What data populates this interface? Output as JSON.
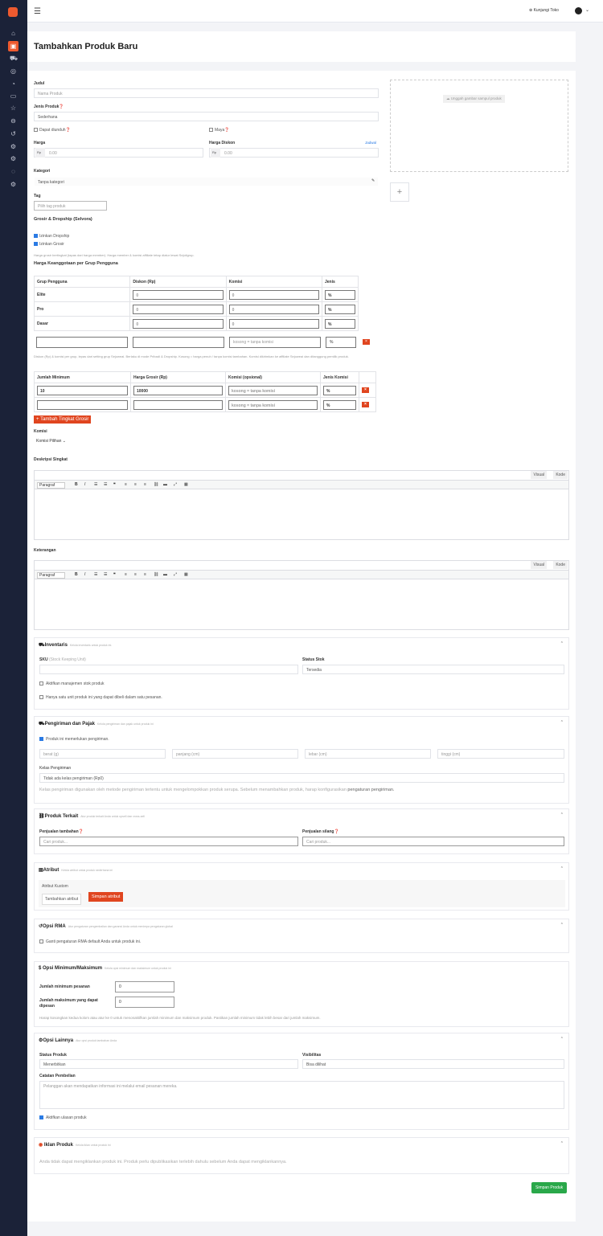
{
  "topbar": {
    "visit": "Kunjungi Toko"
  },
  "page": {
    "title": "Tambahkan Produk Baru"
  },
  "form": {
    "title_label": "Judul",
    "title_ph": "Nama Produk",
    "type_label": "Jenis Produk",
    "type_val": "Sederhana",
    "downloadable": "Dapat diunduh",
    "virtual": "Maya",
    "price_label": "Harga",
    "price_ph": "0.00",
    "currency": "Rp",
    "sale_label": "Harga Diskon",
    "schedule": "Jadwal",
    "cat_label": "Kategori",
    "cat_val": "Tanpa kategori",
    "tag_label": "Tag",
    "tag_ph": "Pilih tag produk",
    "upload": "Unggah gambar sampul produk"
  },
  "grosir": {
    "title": "Grosir & Dropship (Selvora)",
    "allow_dropship": "Izinkan Dropship",
    "allow_grosir": "Izinkan Grosir",
    "note": "Harga grosir bertingkat (tapas dari harga member). Harga member & komisi affiliate tetap diatur lewat Sejoligrup.",
    "member_title": "Harga Keanggotaan per Grup Pengguna"
  },
  "member_table": {
    "headers": [
      "Grup Pengguna",
      "Diskon (Rp)",
      "Komisi",
      "Jenis"
    ],
    "rows": [
      {
        "name": "Elite",
        "d": "0",
        "k": "0",
        "j": "%"
      },
      {
        "name": "Pro",
        "d": "0",
        "k": "0",
        "j": "%"
      },
      {
        "name": "Dasar",
        "d": "0",
        "k": "0",
        "j": "%"
      }
    ],
    "new_k_ph": "kosong = tanpa komisi",
    "new_j": "%"
  },
  "member_note": "Diskon (Rp) & komisi per grup, lepas dari setting grup Sejoweai. Berlaku di mode Pribadi & Dropship. Kosong = harga penuh / tanpa komisi tambahan. Komisi dikirimkan ke affiliate Sejoweai dan ditanggung pemilik produk.",
  "tier_table": {
    "headers": [
      "Jumlah Minimum",
      "Harga Grosir (Rp)",
      "Komisi (opsional)",
      "Jenis Komisi"
    ],
    "rows": [
      {
        "min": "10",
        "price": "10000",
        "k_ph": "kosong = tanpa komisi",
        "j": "%"
      },
      {
        "min": "",
        "price": "",
        "k_ph": "kosong = tanpa komisi",
        "j": "%"
      }
    ],
    "add": "+ Tambah Tingkat Grosir"
  },
  "komisi": {
    "label": "Komisi",
    "val": "Komisi Pilihan"
  },
  "short_desc": {
    "label": "Deskripsi Singkat",
    "visual": "Visual",
    "code": "Kode",
    "para": "Paragraf"
  },
  "desc": {
    "label": "Keterangan",
    "visual": "Visual",
    "code": "Kode",
    "para": "Paragraf"
  },
  "inventory": {
    "title": "Inventaris",
    "hint": "Kelola inventaris untuk produk ini.",
    "sku": "SKU",
    "sku_hint": "(Stock Keeping Unit)",
    "stock_label": "Status Stok",
    "stock_val": "Tersedia",
    "manage": "Aktifkan manajemen stok produk",
    "single": "Hanya satu unit produk ini yang dapat dibeli dalam satu pesanan."
  },
  "shipping": {
    "title": "Pengiriman dan Pajak",
    "hint": "Kelola pengiriman dan pajak untuk produk ini",
    "requires": "Produk ini memerlukan pengiriman.",
    "weight": "berat (g)",
    "length": "panjang (cm)",
    "width": "lebar (cm)",
    "height": "tinggi (cm)",
    "class_label": "Kelas Pengiriman",
    "class_val": "Tidak ada kelas pengiriman (Rp0)",
    "note": "Kelas pengiriman digunakan oleh metode pengiriman tertentu untuk mengelompokkan produk serupa. Sebelum menambahkan produk, harap konfigurasikan",
    "note_link": "pengaturan pengiriman."
  },
  "linked": {
    "title": "Produk Terkait",
    "hint": "Atur produk terkait Anda untuk upsell dan cross-sell",
    "upsell": "Penjualan tambahan",
    "cross": "Penjualan silang",
    "ph": "Cari produk..."
  },
  "attr": {
    "title": "Atribut",
    "hint": "Kelola atribut untuk produk sederhana ini",
    "custom": "Atribut Kustom",
    "add": "Tambahkan atribut",
    "save": "Simpan atribut"
  },
  "rma": {
    "title": "Opsi RMA",
    "hint": "Atur pengaturan pengembalian dan garansi Anda untuk menimpa pengaturan global",
    "override": "Ganti pengaturan RMA default Anda untuk produk ini."
  },
  "minmax": {
    "title": "Opsi Minimum/Maksimum",
    "hint": "Kelola opsi minimum dan maksimum untuk produk ini",
    "min_label": "Jumlah minimum pesanan",
    "min_val": "0",
    "max_label1": "Jumlah maksimum yang dapat",
    "max_label2": "dipesan",
    "max_val": "0",
    "note": "Harap kosongkan kedua kolom atau atur ke 0 untuk menonaktifkan jumlah minimum dan maksimum produk. Pastikan jumlah minimum tidak lebih besar dari jumlah maksimum."
  },
  "other": {
    "title": "Opsi Lainnya",
    "hint": "Atur opsi produk tambahan Anda",
    "status_label": "Status Produk",
    "status_val": "Menerbitkan",
    "vis_label": "Visibilitas",
    "vis_val": "Bisa dilihat",
    "note_label": "Catatan Pembelian",
    "note_ph": "Pelanggan akan mendapatkan informasi ini melalui email pesanan mereka.",
    "reviews": "Aktifkan ulasan produk"
  },
  "ads": {
    "title": "Iklan Produk",
    "hint": "Kelola iklan untuk produk ini",
    "text": "Anda tidak dapat mengiklankan produk ini. Produk perlu dipublikasikan terlebih dahulu sebelum Anda dapat mengiklankannya."
  },
  "save": "Simpan Produk"
}
